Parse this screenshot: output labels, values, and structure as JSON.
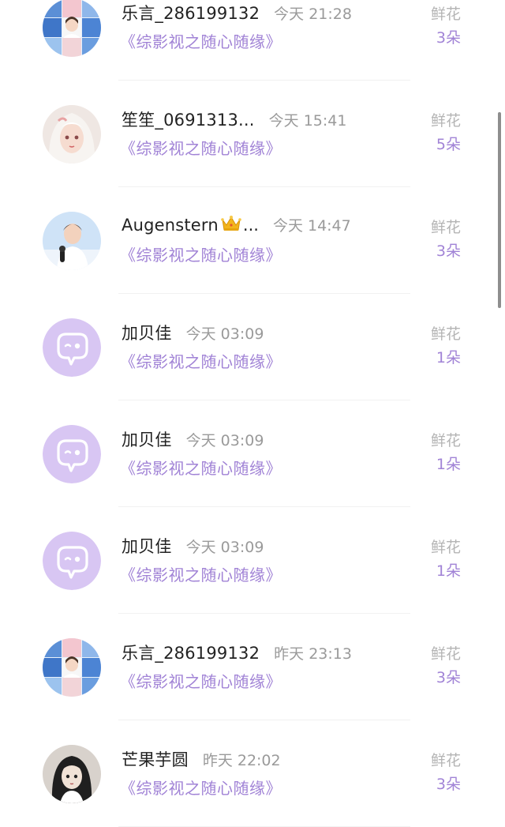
{
  "rows": [
    {
      "avatar": "collage-photo",
      "name": "乐言_286199132",
      "crown": false,
      "time": "今天 21:28",
      "novel": "《综影视之随心随缘》",
      "gift": "鲜花",
      "count": "3朵"
    },
    {
      "avatar": "white-hair-girl",
      "name": "笙笙_0691313...",
      "crown": false,
      "time": "今天 15:41",
      "novel": "《综影视之随心随缘》",
      "gift": "鲜花",
      "count": "5朵"
    },
    {
      "avatar": "man-with-microphone",
      "name": "Augenstern",
      "crown": true,
      "suffix": "...",
      "time": "今天 14:47",
      "novel": "《综影视之随心随缘》",
      "gift": "鲜花",
      "count": "3朵"
    },
    {
      "avatar": "default-chat-bubble",
      "name": "加贝佳",
      "crown": false,
      "time": "今天 03:09",
      "novel": "《综影视之随心随缘》",
      "gift": "鲜花",
      "count": "1朵"
    },
    {
      "avatar": "default-chat-bubble",
      "name": "加贝佳",
      "crown": false,
      "time": "今天 03:09",
      "novel": "《综影视之随心随缘》",
      "gift": "鲜花",
      "count": "1朵"
    },
    {
      "avatar": "default-chat-bubble",
      "name": "加贝佳",
      "crown": false,
      "time": "今天 03:09",
      "novel": "《综影视之随心随缘》",
      "gift": "鲜花",
      "count": "1朵"
    },
    {
      "avatar": "collage-photo",
      "name": "乐言_286199132",
      "crown": false,
      "time": "昨天 23:13",
      "novel": "《综影视之随心随缘》",
      "gift": "鲜花",
      "count": "3朵"
    },
    {
      "avatar": "cartoon-girl",
      "name": "芒果芋圆",
      "crown": false,
      "time": "昨天 22:02",
      "novel": "《综影视之随心随缘》",
      "gift": "鲜花",
      "count": "3朵"
    }
  ],
  "colors": {
    "accent": "#a183d6",
    "name": "#222222",
    "time": "#9a9a9a",
    "gift_label": "#b4b4b4",
    "default_avatar": "#d8c6f3"
  }
}
